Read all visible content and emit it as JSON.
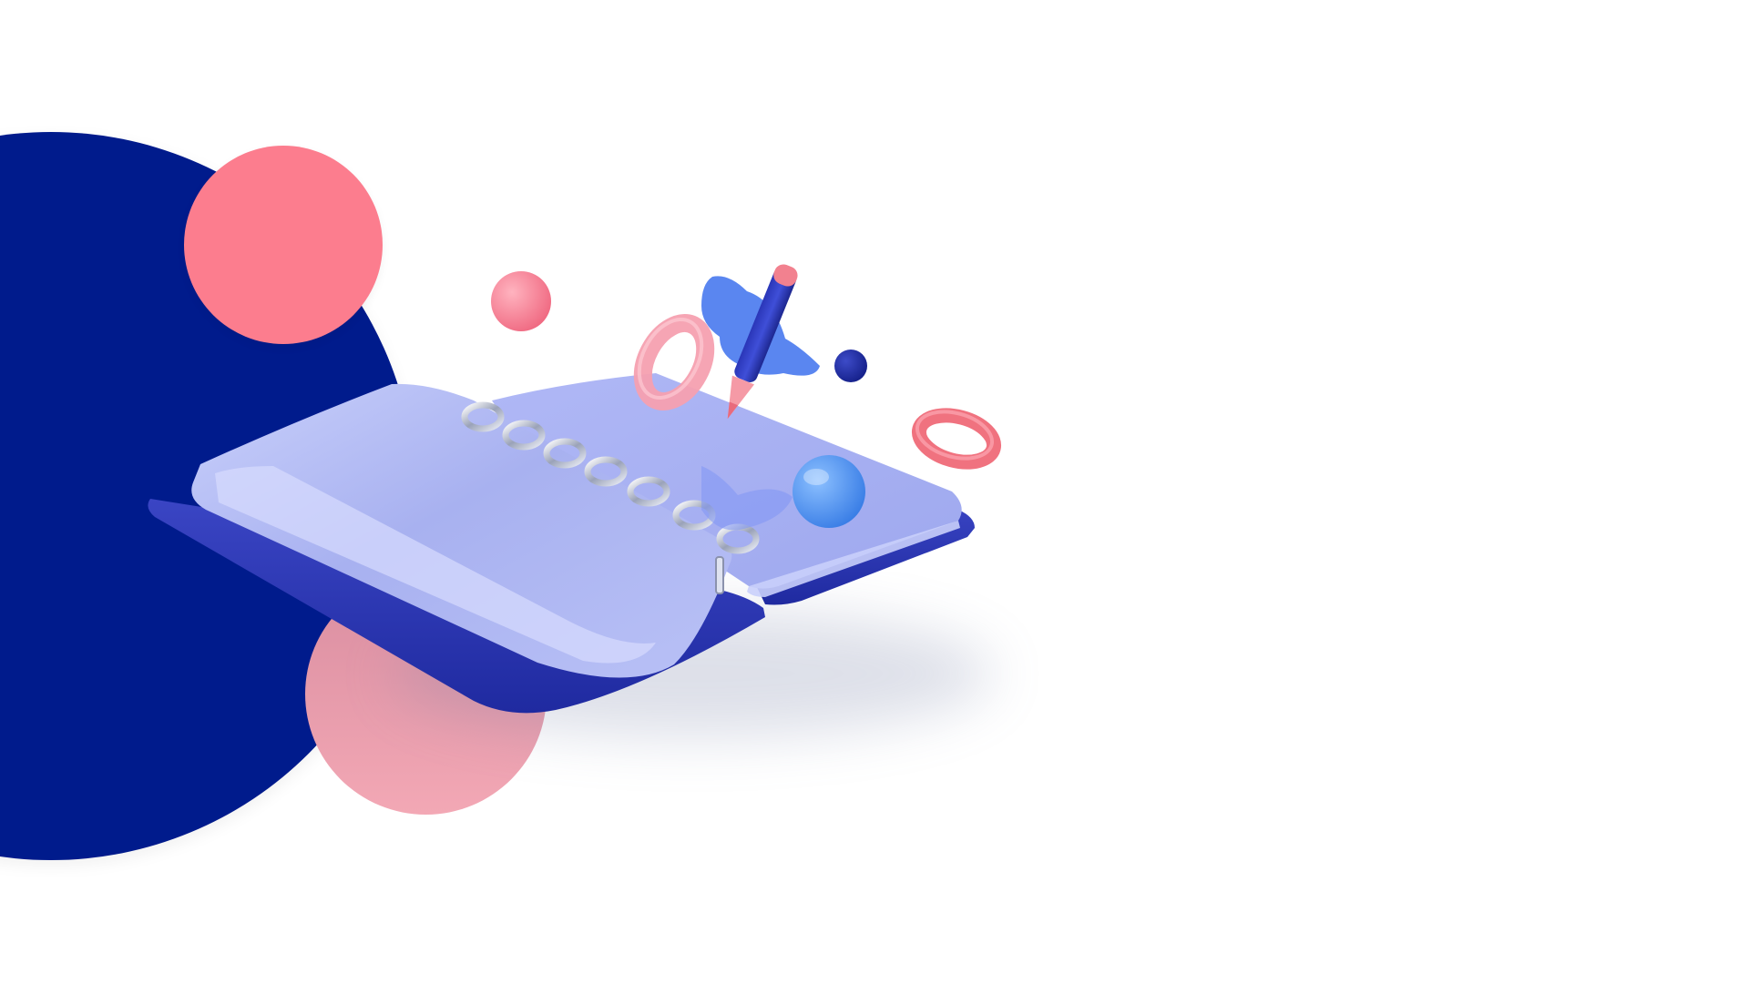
{
  "colors": {
    "background": "#ffffff",
    "navy": "#001b8c",
    "coral": "#fc7d8e",
    "pink": "#f3a8b5",
    "lavender": "#a3acee",
    "blue": "#4f8ef0"
  },
  "illustration": {
    "subject": "open-ring-binder-notebook",
    "icons": [
      "notebook-icon",
      "pencil-icon",
      "sphere-icon",
      "ring-icon",
      "blob-icon"
    ]
  }
}
